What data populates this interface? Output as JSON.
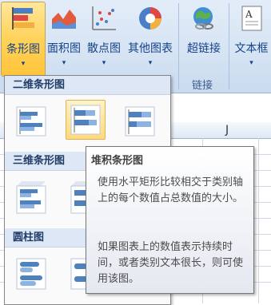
{
  "ribbon": {
    "buttons": [
      {
        "label": "条形图",
        "icon": "bar-chart-icon",
        "has_arrow": true
      },
      {
        "label": "面积图",
        "icon": "area-chart-icon",
        "has_arrow": true
      },
      {
        "label": "散点图",
        "icon": "scatter-chart-icon",
        "has_arrow": true
      },
      {
        "label": "其他图表",
        "icon": "other-charts-icon",
        "has_arrow": true
      },
      {
        "label": "超链接",
        "icon": "hyperlink-icon",
        "has_arrow": false
      },
      {
        "label": "文本框",
        "icon": "textbox-icon",
        "has_arrow": true
      }
    ],
    "group_label_links": "链接",
    "arrow_glyph": "▾"
  },
  "sheet": {
    "column_label": "J"
  },
  "gallery": {
    "sections": [
      {
        "title": "二维条形图",
        "items": [
          "clustered-bar",
          "stacked-bar",
          "100-stacked-bar"
        ]
      },
      {
        "title": "三维条形图",
        "items": [
          "3d-clustered-bar",
          "3d-stacked-bar"
        ]
      },
      {
        "title": "圆柱图",
        "items": [
          "cylinder-clustered-bar",
          "cylinder-stacked-bar"
        ]
      }
    ],
    "selected": "stacked-bar"
  },
  "tooltip": {
    "title": "堆积条形图",
    "description1": "使用水平矩形比较相交于类别轴上的每个数值占总数值的大小。",
    "description2": "如果图表上的数值表示持续时间，或者类别文本很长，则可使用该图。"
  },
  "colors": {
    "ribbon_bg": "#d5e3f3",
    "active_button": "#ffd25a",
    "gallery_header": "#dde7f5",
    "text_blue": "#15428b"
  }
}
